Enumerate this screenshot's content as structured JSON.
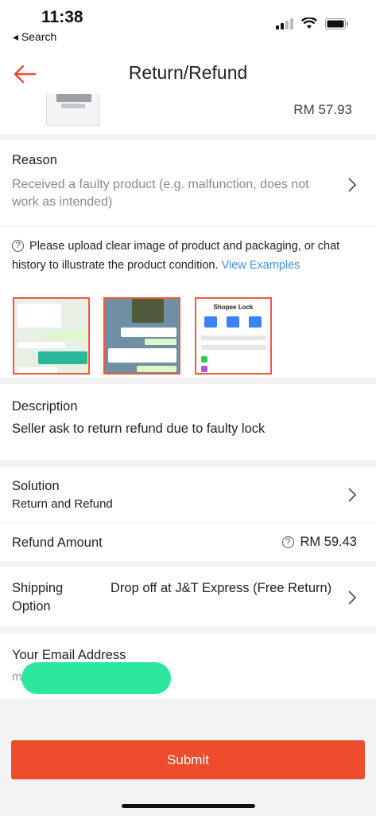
{
  "status_bar": {
    "time": "11:38",
    "back_app": "◂ Search"
  },
  "nav": {
    "title": "Return/Refund"
  },
  "product": {
    "price": "RM 57.93"
  },
  "reason": {
    "label": "Reason",
    "value": "Received a faulty product (e.g. malfunction, does not work as intended)"
  },
  "upload": {
    "note": "Please upload clear image of product and packaging, or chat history to illustrate the product condition.",
    "link": "View Examples",
    "images": [
      {
        "name": "chat-screenshot-1"
      },
      {
        "name": "chat-screenshot-2"
      },
      {
        "name": "shopee-lock-screenshot",
        "caption": "Shopee Lock"
      }
    ]
  },
  "description": {
    "label": "Description",
    "value": "Seller ask to return refund due to faulty lock"
  },
  "solution": {
    "label": "Solution",
    "value": "Return and Refund"
  },
  "refund": {
    "label": "Refund Amount",
    "value": "RM 59.43"
  },
  "shipping": {
    "label": "Shipping Option",
    "value": "Drop off at J&T Express (Free Return)"
  },
  "email": {
    "label": "Your Email Address",
    "value": "m"
  },
  "submit": {
    "label": "Submit"
  },
  "colors": {
    "accent": "#ee4d2d",
    "link": "#3d8fe0",
    "redaction": "#2de6a0"
  }
}
